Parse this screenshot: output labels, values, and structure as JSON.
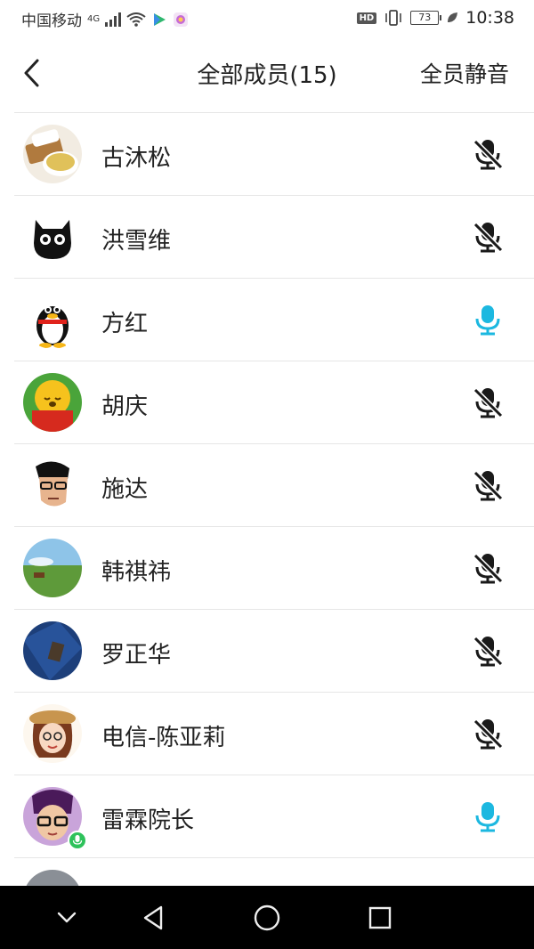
{
  "status_bar": {
    "carrier": "中国移动",
    "network": "4G",
    "hd": "HD",
    "battery": "73",
    "time": "10:38"
  },
  "header": {
    "title": "全部成员(15)",
    "mute_all": "全员静音",
    "back_icon": "chevron-left-icon"
  },
  "colors": {
    "mic_active": "#1cb8e0",
    "mic_muted": "#1a1a1a",
    "online_badge": "#2ec25b"
  },
  "members": [
    {
      "name": "古沐松",
      "mic": "muted"
    },
    {
      "name": "洪雪维",
      "mic": "muted"
    },
    {
      "name": "方红",
      "mic": "active"
    },
    {
      "name": "胡庆",
      "mic": "muted"
    },
    {
      "name": "施达",
      "mic": "muted"
    },
    {
      "name": "韩祺祎",
      "mic": "muted"
    },
    {
      "name": "罗正华",
      "mic": "muted"
    },
    {
      "name": "电信-陈亚莉",
      "mic": "muted"
    },
    {
      "name": "雷霖院长",
      "mic": "active"
    },
    {
      "name": "",
      "mic": "none"
    }
  ],
  "nav_bar": {
    "icons": [
      "chevron-down-icon",
      "back-triangle-icon",
      "home-circle-icon",
      "recents-square-icon"
    ]
  }
}
